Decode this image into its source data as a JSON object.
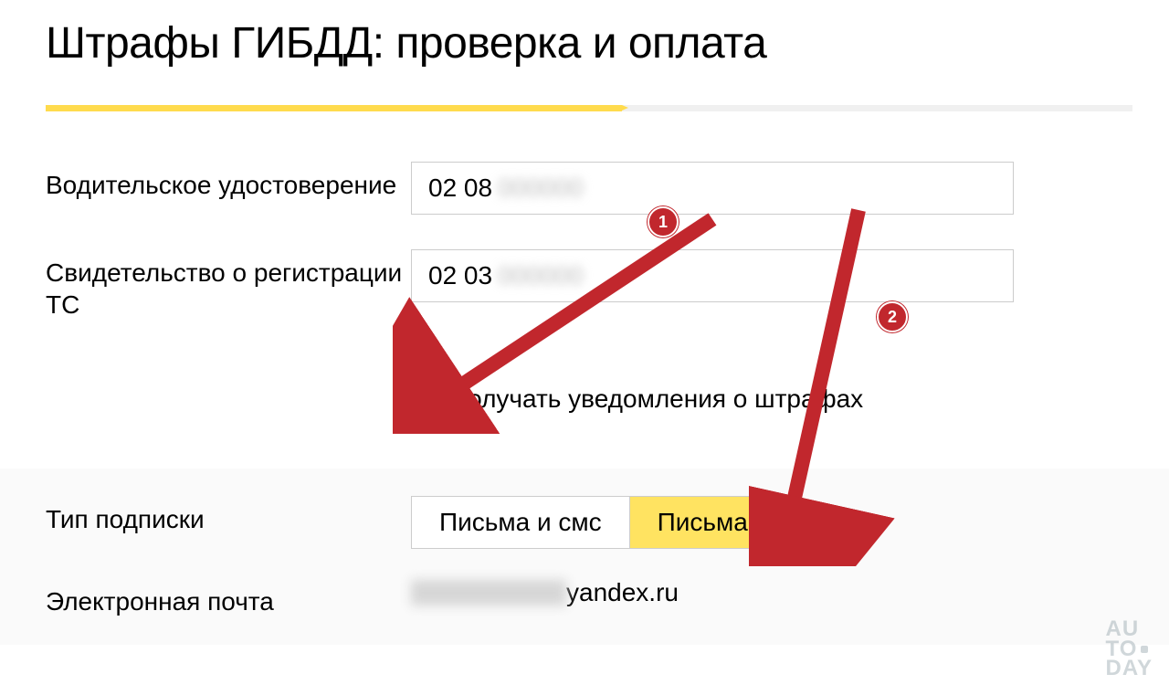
{
  "title": "Штрафы ГИБДД: проверка и оплата",
  "fields": {
    "driver_license": {
      "label": "Водительское удостоверение",
      "value_visible": "02 08",
      "value_hidden": "000000"
    },
    "registration": {
      "label": "Свидетельство о регистрации ТС",
      "value_visible": "02 03",
      "value_hidden": "000000"
    }
  },
  "checkbox": {
    "label": "Получать уведомления о штрафах",
    "checked": true
  },
  "subscription": {
    "label": "Тип подписки",
    "option_a": "Письма и смс",
    "option_b": "Письма",
    "active": "b"
  },
  "email": {
    "label": "Электронная почта",
    "domain": "yandex.ru"
  },
  "annotations": {
    "badge1": "1",
    "badge2": "2"
  },
  "watermark": {
    "l1": "AU",
    "l2": "TO",
    "l3": "DAY"
  }
}
